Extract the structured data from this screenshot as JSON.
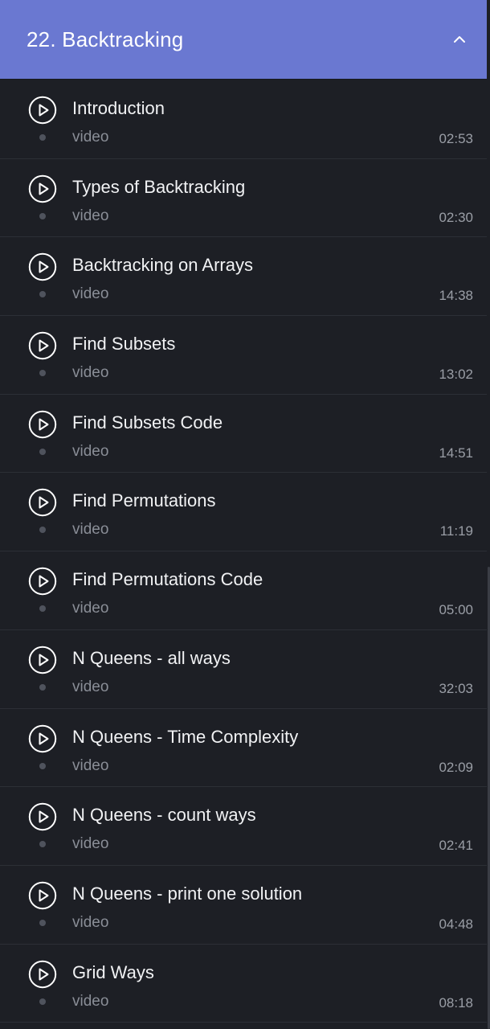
{
  "section": {
    "title": "22. Backtracking",
    "toggle_icon": "chevron-up-icon"
  },
  "colors": {
    "header_bg": "#6a78d1",
    "page_bg": "#1d1f25",
    "divider": "#2c2f36",
    "title_text": "#f1f2f4",
    "meta_text": "#8a8e97"
  },
  "lessons": [
    {
      "title": "Introduction",
      "type": "video",
      "duration": "02:53",
      "icon": "play-circle-icon"
    },
    {
      "title": "Types of Backtracking",
      "type": "video",
      "duration": "02:30",
      "icon": "play-circle-icon"
    },
    {
      "title": "Backtracking on Arrays",
      "type": "video",
      "duration": "14:38",
      "icon": "play-circle-icon"
    },
    {
      "title": "Find Subsets",
      "type": "video",
      "duration": "13:02",
      "icon": "play-circle-icon"
    },
    {
      "title": "Find Subsets Code",
      "type": "video",
      "duration": "14:51",
      "icon": "play-circle-icon"
    },
    {
      "title": "Find Permutations",
      "type": "video",
      "duration": "11:19",
      "icon": "play-circle-icon"
    },
    {
      "title": "Find Permutations Code",
      "type": "video",
      "duration": "05:00",
      "icon": "play-circle-icon"
    },
    {
      "title": "N Queens - all ways",
      "type": "video",
      "duration": "32:03",
      "icon": "play-circle-icon"
    },
    {
      "title": "N Queens - Time Complexity",
      "type": "video",
      "duration": "02:09",
      "icon": "play-circle-icon"
    },
    {
      "title": "N Queens - count ways",
      "type": "video",
      "duration": "02:41",
      "icon": "play-circle-icon"
    },
    {
      "title": "N Queens - print one solution",
      "type": "video",
      "duration": "04:48",
      "icon": "play-circle-icon"
    },
    {
      "title": "Grid Ways",
      "type": "video",
      "duration": "08:18",
      "icon": "play-circle-icon"
    }
  ]
}
